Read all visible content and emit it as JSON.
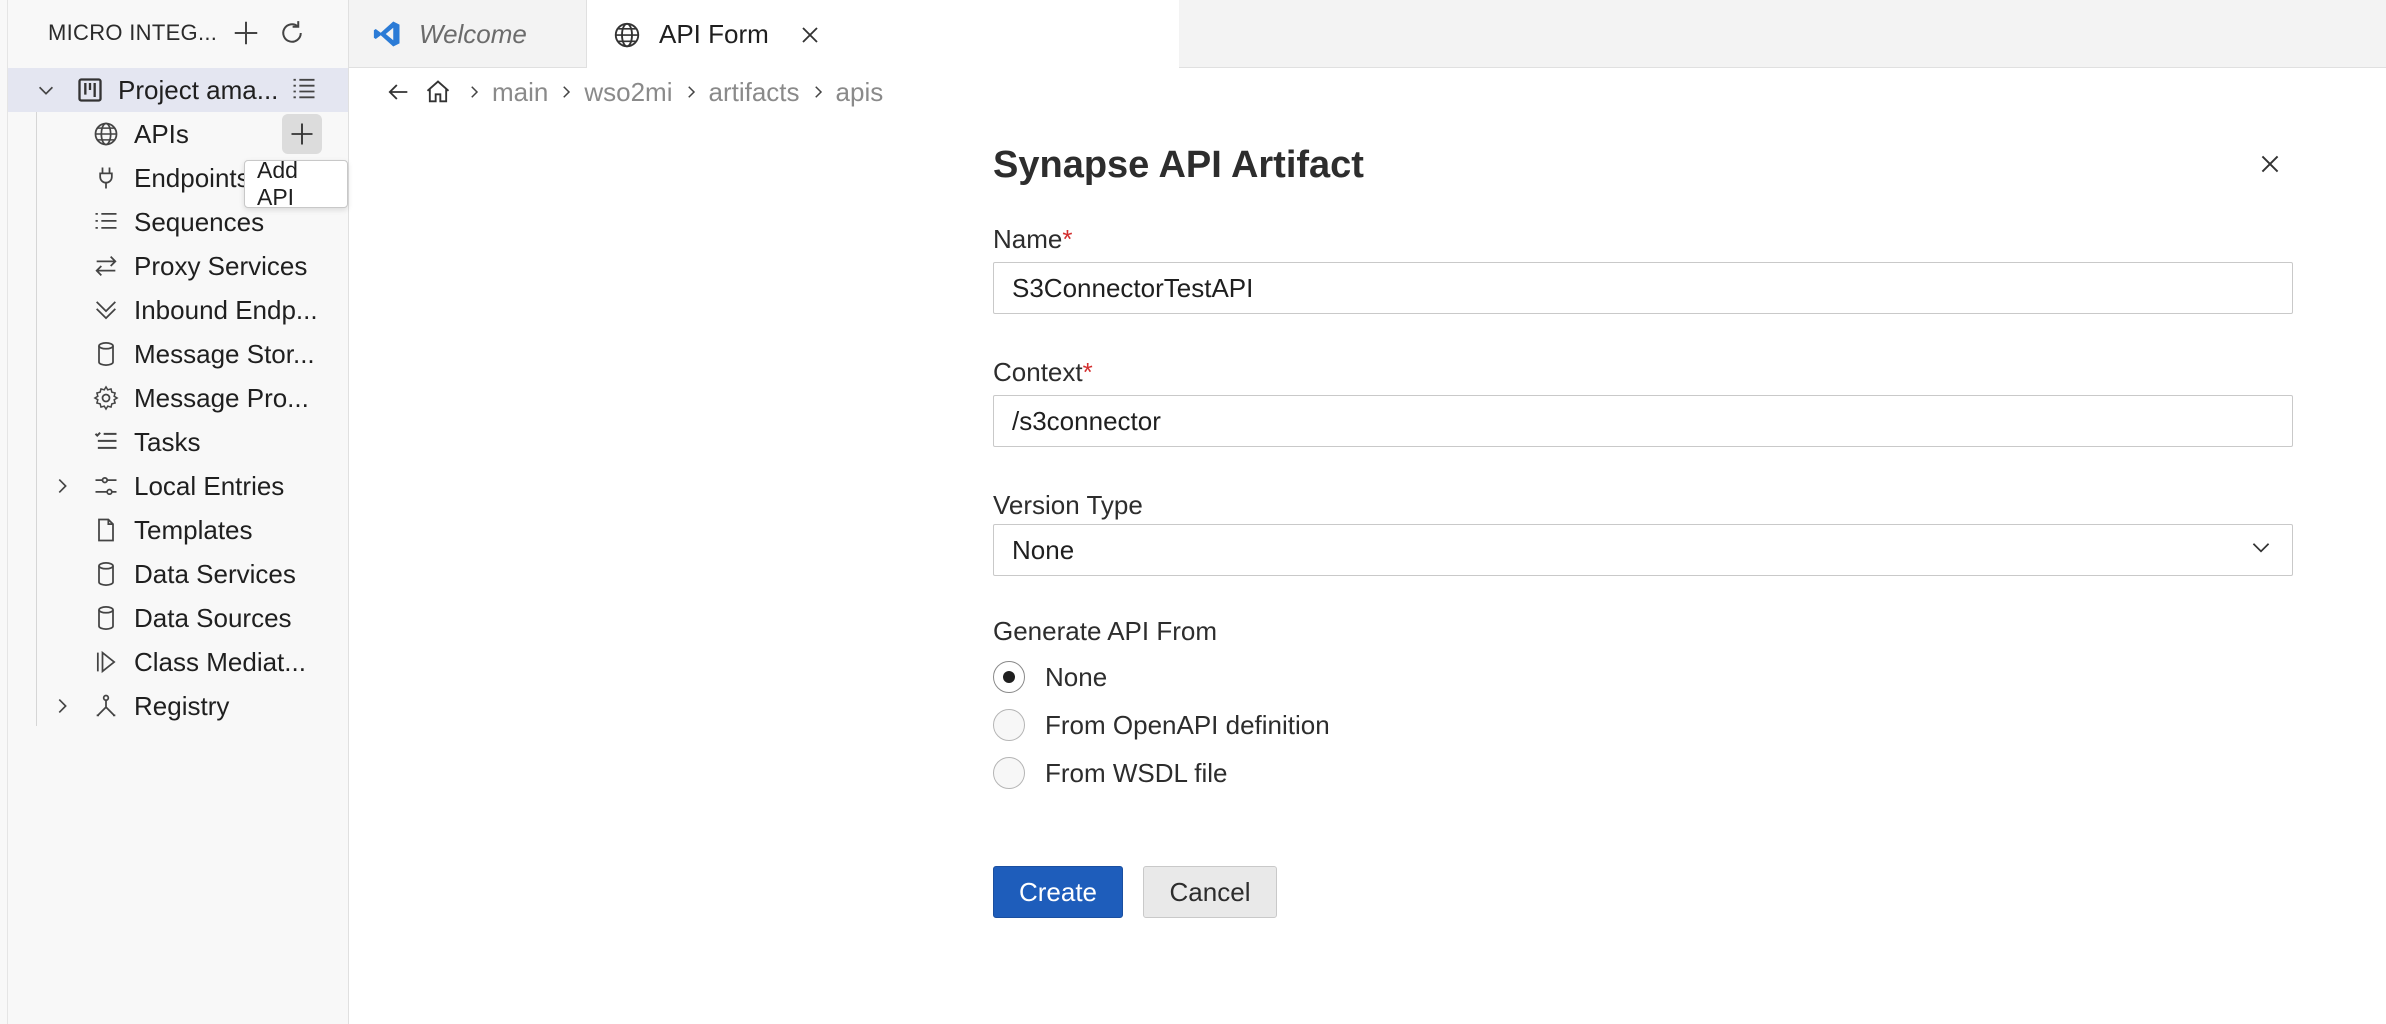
{
  "sidebar": {
    "title": "MICRO INTEG...",
    "header_icons": [
      "add-icon",
      "refresh-icon"
    ],
    "project": {
      "label": "Project ama...",
      "expanded": true
    },
    "items": [
      {
        "label": "APIs",
        "icon": "globe-icon",
        "expandable": false
      },
      {
        "label": "Endpoints",
        "icon": "plug-icon",
        "expandable": false
      },
      {
        "label": "Sequences",
        "icon": "list-icon",
        "expandable": false
      },
      {
        "label": "Proxy Services",
        "icon": "arrows-icon",
        "expandable": false
      },
      {
        "label": "Inbound Endp...",
        "icon": "chevrons-down-icon",
        "expandable": false
      },
      {
        "label": "Message Stor...",
        "icon": "database-icon",
        "expandable": false
      },
      {
        "label": "Message Pro...",
        "icon": "gear-icon",
        "expandable": false
      },
      {
        "label": "Tasks",
        "icon": "checklist-icon",
        "expandable": false
      },
      {
        "label": "Local Entries",
        "icon": "sliders-icon",
        "expandable": true
      },
      {
        "label": "Templates",
        "icon": "file-icon",
        "expandable": false
      },
      {
        "label": "Data Services",
        "icon": "database-icon",
        "expandable": false
      },
      {
        "label": "Data Sources",
        "icon": "database-icon",
        "expandable": false
      },
      {
        "label": "Class Mediat...",
        "icon": "class-mediator-icon",
        "expandable": false
      },
      {
        "label": "Registry",
        "icon": "registry-icon",
        "expandable": true
      }
    ],
    "tooltip": "Add API"
  },
  "tabs": [
    {
      "label": "Welcome",
      "icon": "vscode-icon",
      "active": false
    },
    {
      "label": "API Form",
      "icon": "globe-icon",
      "active": true
    }
  ],
  "breadcrumb": [
    "main",
    "wso2mi",
    "artifacts",
    "apis"
  ],
  "form": {
    "title": "Synapse API Artifact",
    "name_label": "Name",
    "name_value": "S3ConnectorTestAPI",
    "context_label": "Context",
    "context_value": "/s3connector",
    "required_mark": "*",
    "version_type_label": "Version Type",
    "version_type_value": "None",
    "generate_label": "Generate API From",
    "generate_options": [
      {
        "label": "None",
        "checked": true
      },
      {
        "label": "From OpenAPI definition",
        "checked": false
      },
      {
        "label": "From WSDL file",
        "checked": false
      }
    ],
    "create_label": "Create",
    "cancel_label": "Cancel"
  },
  "colors": {
    "accent": "#1e5dbb",
    "selected_row": "#e4e6f1",
    "required": "#d32f2f",
    "vscode_blue": "#2b7bd6"
  }
}
